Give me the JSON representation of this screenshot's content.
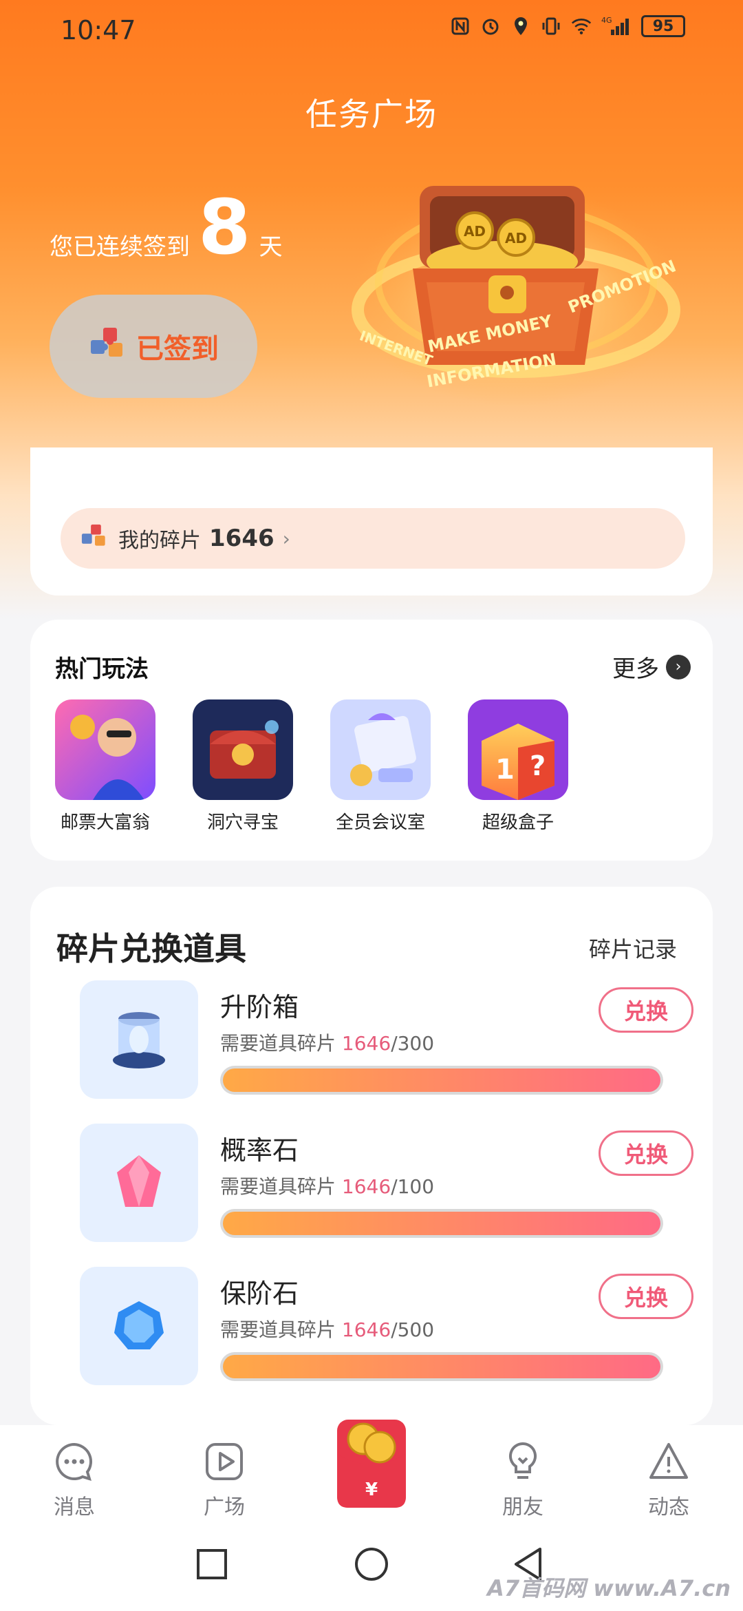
{
  "status_bar": {
    "time": "10:47",
    "network": "4G",
    "battery": "95"
  },
  "header": {
    "title": "任务广场",
    "streak_prefix": "您已连续签到",
    "streak_days": "8",
    "streak_suffix": "天",
    "signed_label": "已签到",
    "chest_text": [
      "AD",
      "AD",
      "MAKE MONEY",
      "PROMOTION",
      "INFORMATION",
      "INTERNET"
    ]
  },
  "fragments": {
    "label": "我的碎片",
    "count": "1646",
    "chevron": "›"
  },
  "hot_games": {
    "title": "热门玩法",
    "more": "更多",
    "items": [
      {
        "label": "邮票大富翁",
        "icon": "stamp-tycoon-icon"
      },
      {
        "label": "洞穴寻宝",
        "icon": "cave-treasure-icon"
      },
      {
        "label": "全员会议室",
        "icon": "meeting-room-icon"
      },
      {
        "label": "超级盒子",
        "icon": "super-box-icon"
      }
    ]
  },
  "exchange": {
    "title": "碎片兑换道具",
    "record": "碎片记录",
    "need_label": "需要道具碎片",
    "items": [
      {
        "name": "升阶箱",
        "have": "1646",
        "need": "/300",
        "button": "兑换",
        "progress": 1.0,
        "icon": "upgrade-box-icon"
      },
      {
        "name": "概率石",
        "have": "1646",
        "need": "/100",
        "button": "兑换",
        "progress": 1.0,
        "icon": "pink-gem-icon"
      },
      {
        "name": "保阶石",
        "have": "1646",
        "need": "/500",
        "button": "兑换",
        "progress": 1.0,
        "icon": "blue-gem-icon"
      }
    ]
  },
  "tabbar": {
    "items": [
      {
        "label": "消息",
        "icon": "message-icon"
      },
      {
        "label": "广场",
        "icon": "play-icon"
      },
      {
        "label": "",
        "icon": "red-packet-icon"
      },
      {
        "label": "朋友",
        "icon": "bulb-icon"
      },
      {
        "label": "动态",
        "icon": "alert-icon"
      }
    ],
    "center_symbol": "¥"
  },
  "watermark": "A7首码网 www.A7.cn",
  "colors": {
    "accent": "#ff7a1f",
    "button_border": "#f07089",
    "highlight": "#e65b7a"
  }
}
